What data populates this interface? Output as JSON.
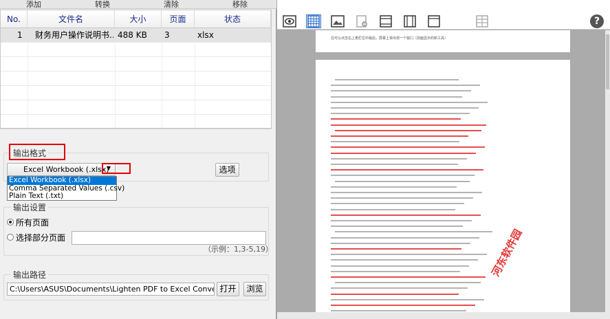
{
  "toolbar": {
    "add": "添加",
    "convert": "转换",
    "clear": "清除",
    "remove": "移除"
  },
  "table": {
    "headers": [
      "No.",
      "文件名",
      "大小",
      "页面",
      "状态"
    ],
    "rows": [
      {
        "no": "1",
        "name": "财务用户操作说明书...",
        "size": "488 KB",
        "pages": "3",
        "status": "xlsx"
      }
    ]
  },
  "output_format": {
    "label": "输出格式",
    "selected": "Excel Workbook (.xlsx)",
    "options": [
      "Excel Workbook (.xlsx)",
      "Comma Separated Values (.csv)",
      "Plain Text (.txt)"
    ],
    "options_button": "选项"
  },
  "output_settings": {
    "label": "输出设置",
    "all_pages": "所有页面",
    "some_pages": "选择部分页面",
    "example": "（示例：1,3-5,19）"
  },
  "output_path": {
    "label": "输出路径",
    "value": "C:\\Users\\ASUS\\Documents\\Lighten PDF to Excel Converter",
    "open_button": "打开",
    "browse_button": "浏览"
  },
  "viewer": {
    "help": "?",
    "tools": [
      "eye-icon",
      "grid-view-icon",
      "image-icon",
      "page-minus-icon",
      "page-fit-icon",
      "page-width-icon",
      "page-single-icon",
      "page-grid-icon"
    ],
    "top_text": "在可以点击右上角栏位中最后，屏幕上将出现一个窗口（前面显示的新工具）",
    "watermark": "河东软件园"
  },
  "colors": {
    "highlight_red": "#e00000",
    "selection_blue": "#0078d7",
    "header_text": "#1a2a8a"
  }
}
